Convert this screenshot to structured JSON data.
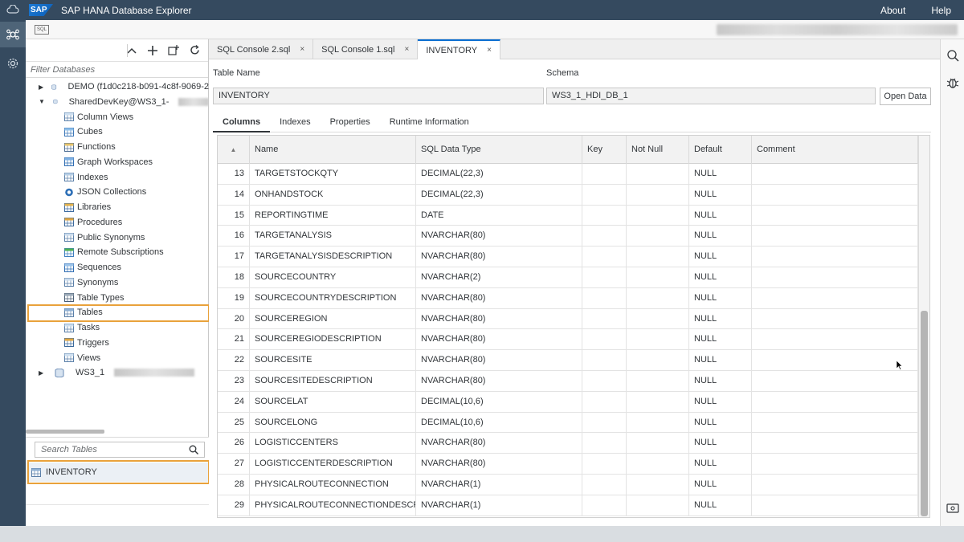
{
  "shell": {
    "logo": "SAP",
    "title": "SAP HANA Database Explorer",
    "about": "About",
    "help": "Help"
  },
  "toolbar": {
    "sql_icon_label": "SQL"
  },
  "left": {
    "filter_placeholder": "Filter Databases",
    "tree": [
      {
        "label": "DEMO (f1d0c218-b091-4c8f-9069-2",
        "level": 0,
        "caret": "right",
        "icon": "database-icon"
      },
      {
        "label": "SharedDevKey@WS3_1-",
        "level": 0,
        "caret": "down",
        "icon": "database-icon"
      },
      {
        "label": "Column Views",
        "level": 1,
        "icon": "column-views-icon"
      },
      {
        "label": "Cubes",
        "level": 1,
        "icon": "cubes-icon"
      },
      {
        "label": "Functions",
        "level": 1,
        "icon": "functions-icon"
      },
      {
        "label": "Graph Workspaces",
        "level": 1,
        "icon": "graph-workspaces-icon"
      },
      {
        "label": "Indexes",
        "level": 1,
        "icon": "indexes-icon"
      },
      {
        "label": "JSON Collections",
        "level": 1,
        "icon": "json-collections-icon"
      },
      {
        "label": "Libraries",
        "level": 1,
        "icon": "libraries-icon"
      },
      {
        "label": "Procedures",
        "level": 1,
        "icon": "procedures-icon"
      },
      {
        "label": "Public Synonyms",
        "level": 1,
        "icon": "public-synonyms-icon"
      },
      {
        "label": "Remote Subscriptions",
        "level": 1,
        "icon": "remote-subscriptions-icon"
      },
      {
        "label": "Sequences",
        "level": 1,
        "icon": "sequences-icon"
      },
      {
        "label": "Synonyms",
        "level": 1,
        "icon": "synonyms-icon"
      },
      {
        "label": "Table Types",
        "level": 1,
        "icon": "table-types-icon"
      },
      {
        "label": "Tables",
        "level": 1,
        "icon": "tables-icon",
        "selected": true
      },
      {
        "label": "Tasks",
        "level": 1,
        "icon": "tasks-icon"
      },
      {
        "label": "Triggers",
        "level": 1,
        "icon": "triggers-icon"
      },
      {
        "label": "Views",
        "level": 1,
        "icon": "views-icon"
      },
      {
        "label": "WS3_1",
        "level": 0,
        "caret": "right",
        "icon": "database-icon"
      }
    ],
    "search_placeholder": "Search Tables",
    "table_result": "INVENTORY"
  },
  "tabs": [
    {
      "label": "SQL Console 2.sql",
      "active": false
    },
    {
      "label": "SQL Console 1.sql",
      "active": false
    },
    {
      "label": "INVENTORY",
      "active": true
    }
  ],
  "tab_close": "×",
  "form": {
    "table_name_label": "Table Name",
    "table_name_value": "INVENTORY",
    "schema_label": "Schema",
    "schema_value": "WS3_1_HDI_DB_1",
    "open_data_label": "Open Data"
  },
  "subtabs": [
    {
      "label": "Columns",
      "active": true
    },
    {
      "label": "Indexes",
      "active": false
    },
    {
      "label": "Properties",
      "active": false
    },
    {
      "label": "Runtime Information",
      "active": false
    }
  ],
  "grid": {
    "sort_indicator": "▲",
    "headers": {
      "name": "Name",
      "type": "SQL Data Type",
      "key": "Key",
      "notnull": "Not Null",
      "default": "Default",
      "comment": "Comment"
    },
    "rows": [
      {
        "n": "13",
        "name": "TARGETSTOCKQTY",
        "type": "DECIMAL(22,3)",
        "default": "NULL"
      },
      {
        "n": "14",
        "name": "ONHANDSTOCK",
        "type": "DECIMAL(22,3)",
        "default": "NULL"
      },
      {
        "n": "15",
        "name": "REPORTINGTIME",
        "type": "DATE",
        "default": "NULL"
      },
      {
        "n": "16",
        "name": "TARGETANALYSIS",
        "type": "NVARCHAR(80)",
        "default": "NULL"
      },
      {
        "n": "17",
        "name": "TARGETANALYSISDESCRIPTION",
        "type": "NVARCHAR(80)",
        "default": "NULL"
      },
      {
        "n": "18",
        "name": "SOURCECOUNTRY",
        "type": "NVARCHAR(2)",
        "default": "NULL"
      },
      {
        "n": "19",
        "name": "SOURCECOUNTRYDESCRIPTION",
        "type": "NVARCHAR(80)",
        "default": "NULL"
      },
      {
        "n": "20",
        "name": "SOURCEREGION",
        "type": "NVARCHAR(80)",
        "default": "NULL"
      },
      {
        "n": "21",
        "name": "SOURCEREGIODESCRIPTION",
        "type": "NVARCHAR(80)",
        "default": "NULL"
      },
      {
        "n": "22",
        "name": "SOURCESITE",
        "type": "NVARCHAR(80)",
        "default": "NULL"
      },
      {
        "n": "23",
        "name": "SOURCESITEDESCRIPTION",
        "type": "NVARCHAR(80)",
        "default": "NULL"
      },
      {
        "n": "24",
        "name": "SOURCELAT",
        "type": "DECIMAL(10,6)",
        "default": "NULL"
      },
      {
        "n": "25",
        "name": "SOURCELONG",
        "type": "DECIMAL(10,6)",
        "default": "NULL"
      },
      {
        "n": "26",
        "name": "LOGISTICCENTERS",
        "type": "NVARCHAR(80)",
        "default": "NULL"
      },
      {
        "n": "27",
        "name": "LOGISTICCENTERDESCRIPTION",
        "type": "NVARCHAR(80)",
        "default": "NULL"
      },
      {
        "n": "28",
        "name": "PHYSICALROUTECONNECTION",
        "type": "NVARCHAR(1)",
        "default": "NULL"
      },
      {
        "n": "29",
        "name": "PHYSICALROUTECONNECTIONDESCRI",
        "type": "NVARCHAR(1)",
        "default": "NULL"
      }
    ]
  },
  "colors": {
    "shell": "#354a5f",
    "highlight": "#e9a23b",
    "accent": "#0a6ed1"
  }
}
